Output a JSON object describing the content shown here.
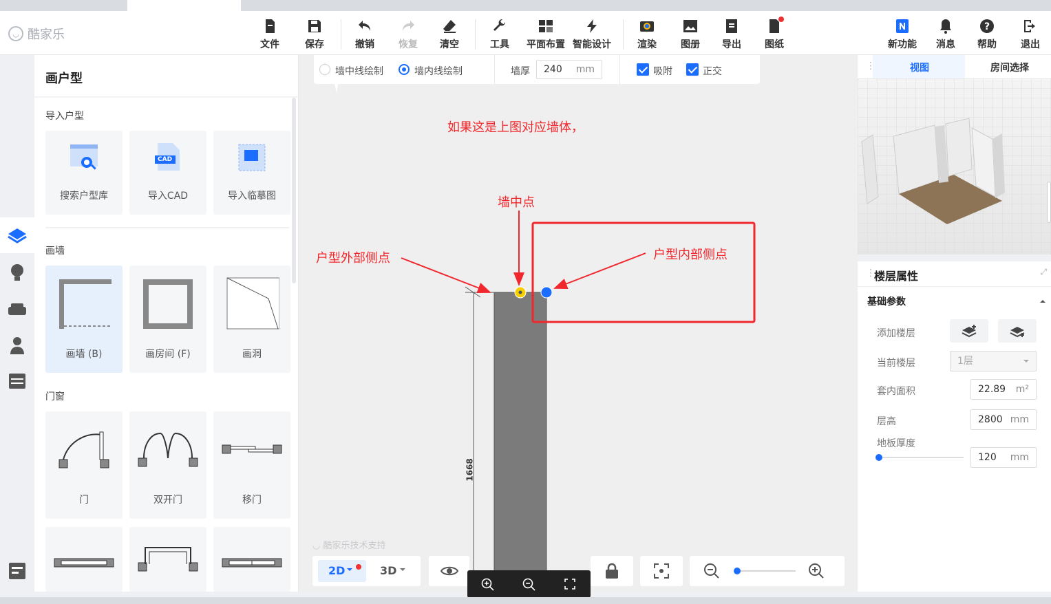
{
  "app": {
    "logo_text": "酷家乐"
  },
  "toolbar": {
    "items": [
      {
        "label": "文件",
        "icon": "file-icon"
      },
      {
        "label": "保存",
        "icon": "save-icon"
      },
      {
        "label": "撤销",
        "icon": "undo-icon"
      },
      {
        "label": "恢复",
        "icon": "redo-icon"
      },
      {
        "label": "清空",
        "icon": "eraser-icon"
      },
      {
        "label": "工具",
        "icon": "wrench-icon"
      },
      {
        "label": "平面布置",
        "icon": "layout-icon"
      },
      {
        "label": "智能设计",
        "icon": "lightning-icon"
      },
      {
        "label": "渲染",
        "icon": "camera-icon"
      },
      {
        "label": "图册",
        "icon": "image-icon"
      },
      {
        "label": "导出",
        "icon": "export-icon"
      },
      {
        "label": "图纸",
        "icon": "drawing-icon"
      },
      {
        "label": "新功能",
        "icon": "new-feature-icon"
      },
      {
        "label": "消息",
        "icon": "bell-icon"
      },
      {
        "label": "帮助",
        "icon": "help-icon"
      },
      {
        "label": "退出",
        "icon": "logout-icon"
      }
    ]
  },
  "left_panel": {
    "title": "画户型",
    "sections": {
      "import": "导入户型",
      "walls": "画墙",
      "doors": "门窗"
    },
    "import_cards": [
      "搜索户型库",
      "导入CAD",
      "导入临摹图"
    ],
    "cad_badge": "CAD",
    "wall_cards": [
      "画墙 (B)",
      "画房间 (F)",
      "画洞"
    ],
    "door_cards": [
      "门",
      "双开门",
      "移门"
    ]
  },
  "options_bar": {
    "mode_center": "墙中线绘制",
    "mode_inner": "墙内线绘制",
    "thickness_label": "墙厚",
    "thickness_value": "240",
    "thickness_unit": "mm",
    "snap_label": "吸附",
    "ortho_label": "正交"
  },
  "annotations": {
    "heading": "如果这是上图对应墙体，",
    "mid_point": "墙中点",
    "outer_point": "户型外部侧点",
    "inner_point": "户型内部侧点"
  },
  "canvas": {
    "dimension": "1668",
    "watermark": "酷家乐技术支持",
    "view_2d": "2D",
    "view_3d": "3D"
  },
  "right_panel": {
    "tab_view": "视图",
    "tab_room": "房间选择",
    "title": "楼层属性",
    "basic_params": "基础参数",
    "add_floor_label": "添加楼层",
    "current_floor_label": "当前楼层",
    "current_floor_value": "1层",
    "area_label": "套内面积",
    "area_value": "22.89",
    "area_unit": "m²",
    "height_label": "层高",
    "height_value": "2800",
    "height_unit": "mm",
    "floor_thickness_label": "地板厚度",
    "floor_thickness_value": "120",
    "floor_thickness_unit": "mm"
  },
  "colors": {
    "accent": "#1a6dff",
    "annotation": "#f0282d",
    "wall": "#7b7b7b"
  }
}
